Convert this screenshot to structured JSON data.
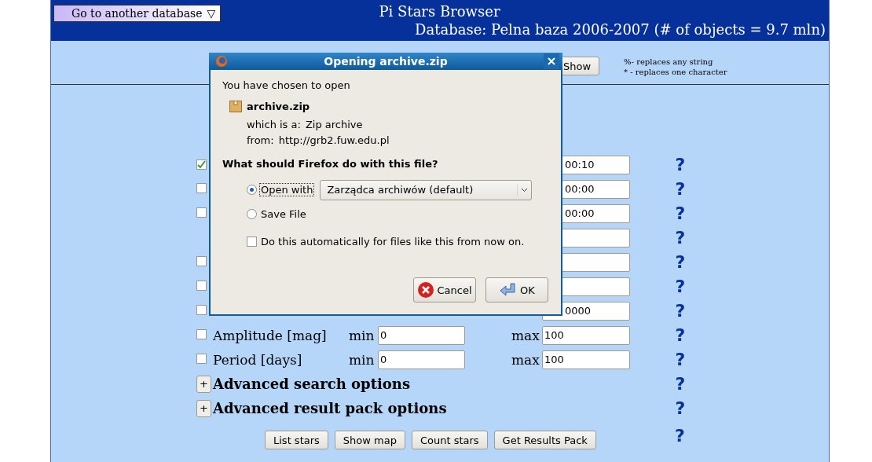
{
  "header": {
    "db_button": "Go to another database",
    "db_caret": "▽",
    "title": "Pi Stars Browser",
    "database": "Database: Pelna baza 2006-2007 (# of objects = 9.7 mln)"
  },
  "search": {
    "button": "Show",
    "hints": [
      "%- replaces any string",
      "* - replaces one character"
    ]
  },
  "rows": [
    {
      "checked": true,
      "max_value": "00:10",
      "help": "?"
    },
    {
      "checked": false,
      "max_value": "00:00",
      "help": "?"
    },
    {
      "checked": false,
      "max_value": "00:00",
      "help": "?"
    },
    {
      "help": "?"
    },
    {
      "checked": false,
      "help": "?"
    },
    {
      "checked": false,
      "help": "?"
    },
    {
      "checked": false,
      "max_value": "0000",
      "help": "?"
    },
    {
      "checked": false,
      "label": "Amplitude [mag]",
      "min_label": "min",
      "min_value": "0",
      "max_label": "max",
      "max_value": "100",
      "help": "?"
    },
    {
      "checked": false,
      "label": "Period [days]",
      "min_label": "min",
      "min_value": "0",
      "max_label": "max",
      "max_value": "100",
      "help": "?"
    }
  ],
  "sections": [
    {
      "toggle": "+",
      "label": "Advanced search options",
      "help": "?"
    },
    {
      "toggle": "+",
      "label": "Advanced result pack options",
      "help": "?"
    }
  ],
  "buttons": [
    "List stars",
    "Show map",
    "Count stars",
    "Get Results Pack"
  ],
  "buttons_help": "?",
  "dialog": {
    "title": "Opening archive.zip",
    "intro": "You have chosen to open",
    "file_name": "archive.zip",
    "type_label": "which is a:",
    "type_value": "Zip archive",
    "from_label": "from:",
    "from_value": "http://grb2.fuw.edu.pl",
    "question": "What should Firefox do with this file?",
    "options": [
      {
        "label": "Open with",
        "selected": true
      },
      {
        "label": "Save File",
        "selected": false
      }
    ],
    "app": "Zarządca archiwów (default)",
    "auto": {
      "label": "Do this automatically for files like this from now on.",
      "checked": false
    },
    "buttons": [
      {
        "kind": "cancel",
        "label": "Cancel"
      },
      {
        "kind": "ok",
        "label": "OK"
      }
    ]
  }
}
